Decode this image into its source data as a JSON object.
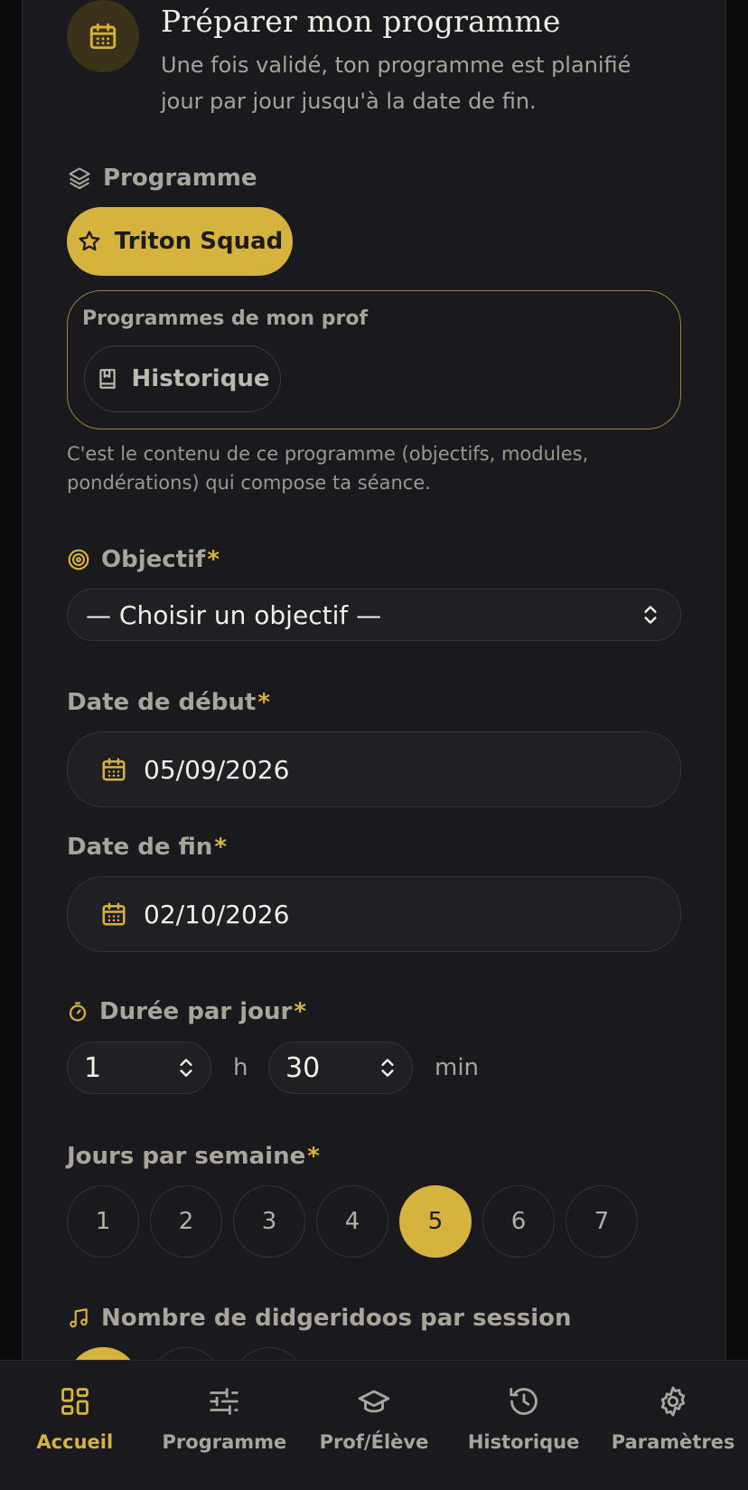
{
  "header": {
    "title": "Préparer mon programme",
    "subtitle": "Une fois validé, ton programme est planifié jour par jour jusqu'à la date de fin."
  },
  "programme": {
    "label": "Programme",
    "selected": "Triton Squad",
    "prof_section_title": "Programmes de mon prof",
    "prof_option": "Historique",
    "help": "C'est le contenu de ce programme (objectifs, modules, pondérations) qui compose ta séance."
  },
  "objectif": {
    "label": "Objectif",
    "required": "*",
    "value": "— Choisir un objectif —"
  },
  "start_date": {
    "label": "Date de début",
    "required": "*",
    "value": "05/09/2026"
  },
  "end_date": {
    "label": "Date de fin",
    "required": "*",
    "value": "02/10/2026"
  },
  "duration": {
    "label": "Durée par jour",
    "required": "*",
    "hours": "1",
    "hours_unit": "h",
    "minutes": "30",
    "minutes_unit": "min"
  },
  "days_per_week": {
    "label": "Jours par semaine",
    "required": "*",
    "options": [
      "1",
      "2",
      "3",
      "4",
      "5",
      "6",
      "7"
    ],
    "selected": "5"
  },
  "didgeridoos": {
    "label": "Nombre de didgeridoos par session"
  },
  "nav": {
    "items": [
      {
        "label": "Accueil",
        "icon": "grid-icon",
        "active": true
      },
      {
        "label": "Programme",
        "icon": "sliders-icon",
        "active": false
      },
      {
        "label": "Prof/Élève",
        "icon": "graduation-cap-icon",
        "active": false
      },
      {
        "label": "Historique",
        "icon": "history-icon",
        "active": false
      },
      {
        "label": "Paramètres",
        "icon": "gear-icon",
        "active": false
      }
    ]
  },
  "colors": {
    "accent": "#d6b23e",
    "background": "#1a1a1e",
    "muted_text": "#a9a59b"
  }
}
